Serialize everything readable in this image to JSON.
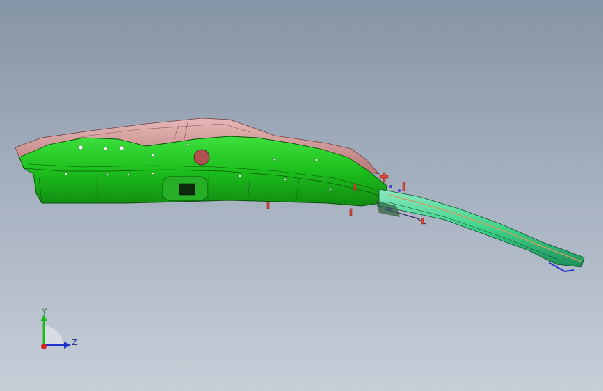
{
  "viewport": {
    "background_top": "#8694a7",
    "background_bottom": "#c6cfd8"
  },
  "model": {
    "body_color": "#1fc81f",
    "inner_color": "#d39a9a",
    "rail_color": "#3fd38a",
    "fastener_color": "#e2463a"
  },
  "triad": {
    "y_label": "Y",
    "z_label": "Z",
    "y_color": "#22b822",
    "z_color": "#2233cc",
    "origin_color": "#d22222"
  }
}
